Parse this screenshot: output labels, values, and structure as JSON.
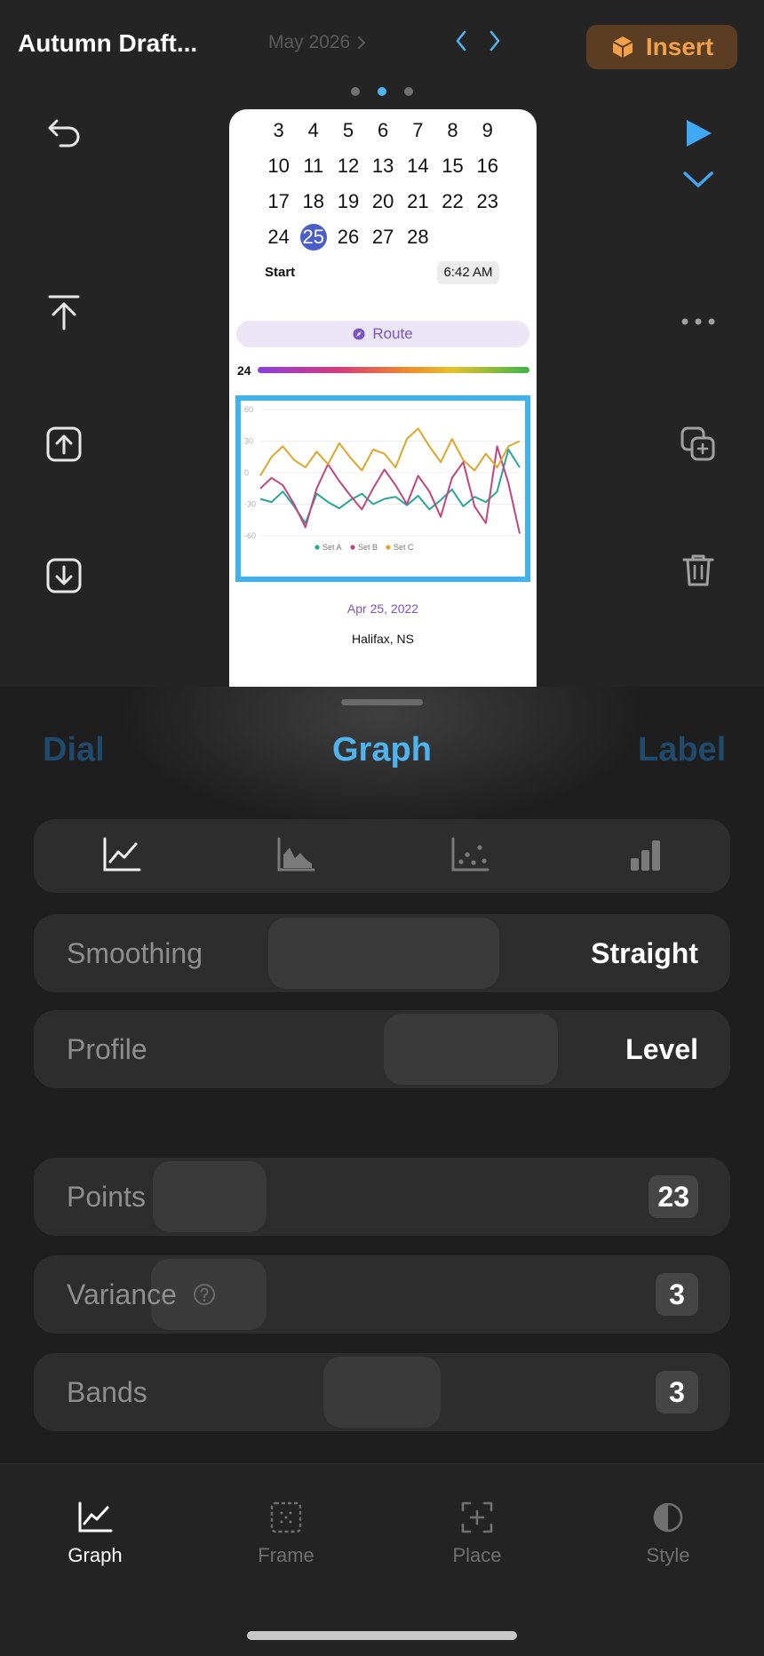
{
  "header": {
    "doc_title": "Autumn Draft...",
    "month": "May 2026",
    "insert_label": "Insert"
  },
  "preview": {
    "calendar_days": [
      "3",
      "4",
      "5",
      "6",
      "7",
      "8",
      "9",
      "10",
      "11",
      "12",
      "13",
      "14",
      "15",
      "16",
      "17",
      "18",
      "19",
      "20",
      "21",
      "22",
      "23",
      "24",
      "25",
      "26",
      "27",
      "28"
    ],
    "selected_day": "25",
    "start_label": "Start",
    "start_time": "6:42 AM",
    "route_label": "Route",
    "gradient_number": "24",
    "date_text": "Apr 25, 2022",
    "place_text": "Halifax, NS"
  },
  "chart_data": {
    "type": "line",
    "ylim": [
      -60,
      60
    ],
    "y_ticks": [
      "60",
      "30",
      "0",
      "-30",
      "-60"
    ],
    "x_count": 24,
    "legend_placement": "bottom",
    "series": [
      {
        "name": "Set A",
        "color": "#26a69a",
        "values": [
          -25,
          -28,
          -18,
          -32,
          -48,
          -20,
          -28,
          -34,
          -26,
          -20,
          -30,
          -25,
          -23,
          -31,
          -22,
          -35,
          -26,
          -16,
          -32,
          -23,
          -28,
          -18,
          22,
          5
        ]
      },
      {
        "name": "Set B",
        "color": "#c2457e",
        "values": [
          -15,
          -5,
          -12,
          -30,
          -52,
          -15,
          8,
          -8,
          -22,
          -35,
          -15,
          3,
          -12,
          -30,
          -3,
          -18,
          -42,
          -5,
          10,
          -32,
          -48,
          25,
          -10,
          -58
        ]
      },
      {
        "name": "Set C",
        "color": "#e0a62a",
        "values": [
          -3,
          15,
          25,
          12,
          5,
          20,
          8,
          28,
          14,
          2,
          22,
          18,
          5,
          32,
          42,
          25,
          10,
          32,
          12,
          2,
          18,
          5,
          25,
          30
        ]
      }
    ]
  },
  "sheet": {
    "mode_tabs": [
      "Dial",
      "Graph",
      "Label"
    ],
    "active_mode": "Graph",
    "rows": {
      "smoothing": {
        "label": "Smoothing",
        "value": "Straight"
      },
      "profile": {
        "label": "Profile",
        "value": "Level"
      },
      "points": {
        "label": "Points",
        "value": "23"
      },
      "variance": {
        "label": "Variance",
        "value": "3"
      },
      "bands": {
        "label": "Bands",
        "value": "3"
      }
    }
  },
  "tabbar": {
    "tabs": [
      "Graph",
      "Frame",
      "Place",
      "Style"
    ],
    "active": "Graph"
  },
  "colors": {
    "accent": "#4fb3f0",
    "insert_text": "#f2a04a",
    "insert_bg": "#5a3d22",
    "route": "#7a55c4"
  }
}
